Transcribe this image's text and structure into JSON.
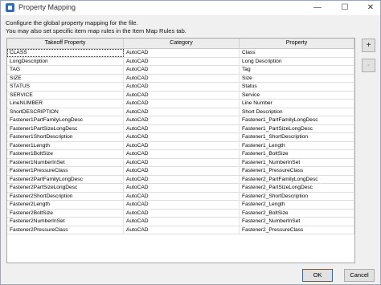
{
  "window": {
    "title": "Property Mapping"
  },
  "description": {
    "line1": "Configure the global property mapping for the file.",
    "line2": "You may also set specific item map rules in the Item Map Rules tab."
  },
  "table": {
    "columns": [
      "Takeoff Property",
      "Category",
      "Property"
    ],
    "rows": [
      [
        "CLASS",
        "AutoCAD",
        "Class"
      ],
      [
        "LongDescription",
        "AutoCAD",
        "Long Description"
      ],
      [
        "TAG",
        "AutoCAD",
        "Tag"
      ],
      [
        "SIZE",
        "AutoCAD",
        "Size"
      ],
      [
        "STATUS",
        "AutoCAD",
        "Status"
      ],
      [
        "SERVICE",
        "AutoCAD",
        "Service"
      ],
      [
        "LineNUMBER",
        "AutoCAD",
        "Line Number"
      ],
      [
        "ShortDESCRIPTION",
        "AutoCAD",
        "Short Description"
      ],
      [
        "Fastener1PartFamilyLongDesc",
        "AutoCAD",
        "Fastener1_PartFamilyLongDesc"
      ],
      [
        "Fastener1PartSizeLongDesc",
        "AutoCAD",
        "Fastener1_PartSizeLongDesc"
      ],
      [
        "Fastener1ShortDescription",
        "AutoCAD",
        "Fastener1_ShortDescription"
      ],
      [
        "Fastener1Length",
        "AutoCAD",
        "Fastener1_Length"
      ],
      [
        "Fastener1BoltSize",
        "AutoCAD",
        "Fastener1_BoltSize"
      ],
      [
        "Fastener1NumberInSet",
        "AutoCAD",
        "Fastener1_NumberInSet"
      ],
      [
        "Fastener1PressureClass",
        "AutoCAD",
        "Fastener1_PressureClass"
      ],
      [
        "Fastener2PartFamilyLongDesc",
        "AutoCAD",
        "Fastener2_PartFamilyLongDesc"
      ],
      [
        "Fastener2PartSizeLongDesc",
        "AutoCAD",
        "Fastener2_PartSizeLongDesc"
      ],
      [
        "Fastener2ShortDescription",
        "AutoCAD",
        "Fastener2_ShortDescription"
      ],
      [
        "Fastener2Length",
        "AutoCAD",
        "Fastener2_Length"
      ],
      [
        "Fastener2BoltSize",
        "AutoCAD",
        "Fastener2_BoltSize"
      ],
      [
        "Fastener2NumberInSet",
        "AutoCAD",
        "Fastener2_NumberInSet"
      ],
      [
        "Fastener2PressureClass",
        "AutoCAD",
        "Fastener2_PressureClass"
      ]
    ]
  },
  "side_buttons": {
    "add": "+",
    "remove": "-"
  },
  "footer": {
    "ok": "OK",
    "cancel": "Cancel"
  }
}
